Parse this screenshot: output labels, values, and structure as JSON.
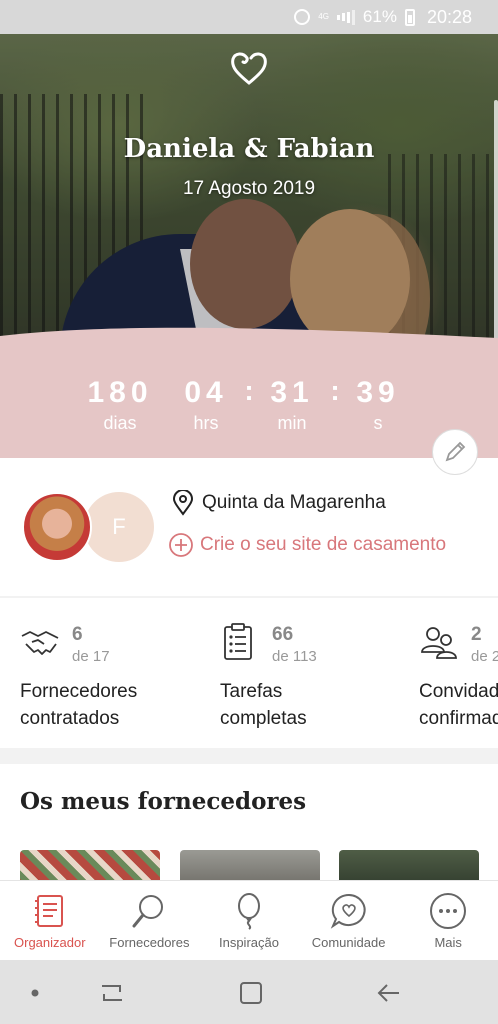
{
  "status_bar": {
    "network": "4G",
    "battery": "61%",
    "time": "20:28"
  },
  "hero": {
    "names": "Daniela & Fabian",
    "date": "17 Agosto 2019"
  },
  "countdown": {
    "days": "180",
    "days_label": "dias",
    "hours": "04",
    "hours_label": "hrs",
    "minutes": "31",
    "minutes_label": "min",
    "seconds": "39",
    "seconds_label": "s",
    "separator": ":"
  },
  "profile": {
    "partner_initial": "F",
    "venue": "Quinta da Magarenha",
    "create_site": "Crie o seu site de casamento"
  },
  "stats": [
    {
      "count": "6",
      "total": "de 17",
      "title_line1": "Fornecedores",
      "title_line2": "contratados",
      "icon": "handshake-icon"
    },
    {
      "count": "66",
      "total": "de 113",
      "title_line1": "Tarefas",
      "title_line2": "completas",
      "icon": "clipboard-checklist-icon"
    },
    {
      "count": "2",
      "total": "de 2",
      "title_line1": "Convidados",
      "title_line2": "confirmados",
      "icon": "guests-icon"
    }
  ],
  "suppliers": {
    "title": "Os meus fornecedores"
  },
  "bottom_nav": [
    {
      "label": "Organizador",
      "icon": "notebook-icon",
      "active": true
    },
    {
      "label": "Fornecedores",
      "icon": "magnifier-icon",
      "active": false
    },
    {
      "label": "Inspiração",
      "icon": "balloon-icon",
      "active": false
    },
    {
      "label": "Comunidade",
      "icon": "chat-heart-icon",
      "active": false
    },
    {
      "label": "Mais",
      "icon": "more-dots-icon",
      "active": false
    }
  ],
  "colors": {
    "accent": "#d9534f",
    "countdown_bg": "#e5c6c6",
    "link": "#d8777b"
  }
}
